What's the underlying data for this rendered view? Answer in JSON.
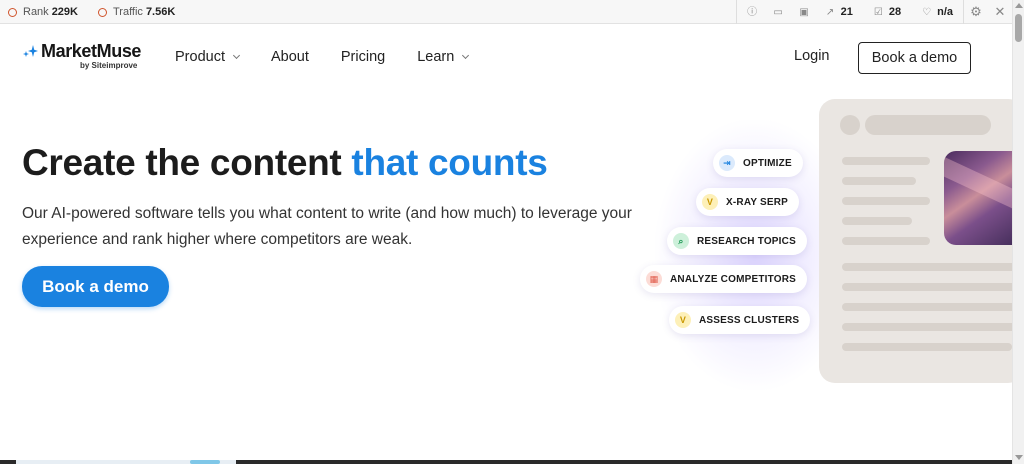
{
  "ext_bar": {
    "rank_label": "Rank",
    "rank_value": "229K",
    "traffic_label": "Traffic",
    "traffic_value": "7.56K",
    "backlinks_value": "21",
    "pages_value": "28",
    "score_value": "n/a",
    "icons": [
      "info-icon",
      "monitor-icon",
      "chart-icon",
      "external-link-icon",
      "check-square-icon",
      "heart-icon",
      "gear-icon",
      "close-icon"
    ],
    "accent_color": "#d0542c"
  },
  "nav": {
    "brand_name": "MarketMuse",
    "brand_sub": "by Siteimprove",
    "links": [
      {
        "label": "Product",
        "has_dropdown": true
      },
      {
        "label": "About",
        "has_dropdown": false
      },
      {
        "label": "Pricing",
        "has_dropdown": false
      },
      {
        "label": "Learn",
        "has_dropdown": true
      }
    ],
    "login_label": "Login",
    "book_demo_label": "Book a demo"
  },
  "hero": {
    "title_main": "Create the content",
    "title_accent": "that counts",
    "subtitle": "Our AI-powered software tells you what content to write (and how much) to leverage your experience and rank higher where competitors are weak.",
    "cta_label": "Book a demo",
    "accent_color": "#1a82e0"
  },
  "features": [
    {
      "label": "OPTIMIZE",
      "icon": "optimize-icon",
      "glyph": "⇥",
      "color": "#1a82e0",
      "bg": "#dbeafc"
    },
    {
      "label": "X-RAY SERP",
      "icon": "xray-icon",
      "glyph": "V",
      "color": "#c99700",
      "bg": "#fdf0b8"
    },
    {
      "label": "RESEARCH TOPICS",
      "icon": "research-icon",
      "glyph": "⌕",
      "color": "#1f9a55",
      "bg": "#cdf0da"
    },
    {
      "label": "ANALYZE COMPETITORS",
      "icon": "competitors-icon",
      "glyph": "▦",
      "color": "#e05a4a",
      "bg": "#fcdcd6"
    },
    {
      "label": "ASSESS CLUSTERS",
      "icon": "clusters-icon",
      "glyph": "V",
      "color": "#c99700",
      "bg": "#fdf0b8"
    }
  ]
}
